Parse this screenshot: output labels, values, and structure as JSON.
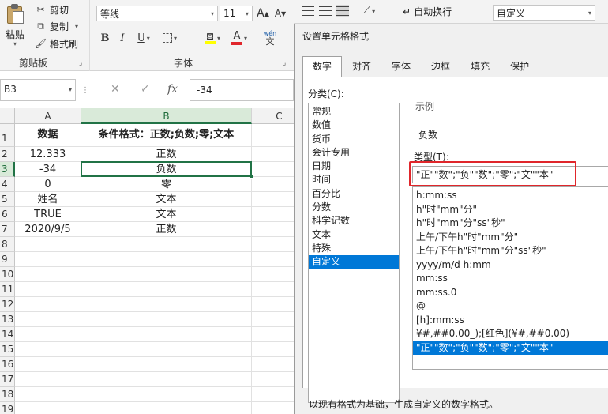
{
  "ribbon": {
    "clipboard": {
      "paste_label": "粘贴",
      "cut_label": "剪切",
      "copy_label": "复制",
      "format_painter_label": "格式刷",
      "group_label": "剪贴板"
    },
    "font": {
      "font_name": "等线",
      "font_size": "11",
      "grow_label": "A",
      "shrink_label": "A",
      "bold_label": "B",
      "italic_label": "I",
      "underline_label": "U",
      "fill_icon": "paint-bucket-icon",
      "font_color_label": "A",
      "phonetic_label": "wén",
      "phonetic_char": "文",
      "group_label": "字体",
      "fill_color": "#ffff00",
      "font_color": "#e0262b"
    },
    "alignment": {
      "wrap_text_label": "自动换行"
    },
    "number": {
      "format_value": "自定义"
    }
  },
  "formula_bar": {
    "name_box": "B3",
    "formula_value": "-34"
  },
  "sheet": {
    "columns": [
      "A",
      "B",
      "C"
    ],
    "rows": [
      "1",
      "2",
      "3",
      "4",
      "5",
      "6",
      "7",
      "8",
      "9",
      "10",
      "11",
      "12",
      "13",
      "14",
      "15",
      "16",
      "17",
      "18",
      "19"
    ],
    "header": {
      "a": "数据",
      "b": "条件格式：正数;负数;零;文本"
    },
    "data": [
      {
        "a": "12.333",
        "b": "正数"
      },
      {
        "a": "-34",
        "b": "负数"
      },
      {
        "a": "0",
        "b": "零"
      },
      {
        "a": "姓名",
        "b": "文本"
      },
      {
        "a": "TRUE",
        "b": "文本"
      },
      {
        "a": "2020/9/5",
        "b": "正数"
      }
    ],
    "selection_color": "#217346"
  },
  "dialog": {
    "title": "设置单元格格式",
    "tabs": [
      "数字",
      "对齐",
      "字体",
      "边框",
      "填充",
      "保护"
    ],
    "category_label": "分类(C):",
    "categories": [
      "常规",
      "数值",
      "货币",
      "会计专用",
      "日期",
      "时间",
      "百分比",
      "分数",
      "科学记数",
      "文本",
      "特殊",
      "自定义"
    ],
    "selected_category": 11,
    "sample_label": "示例",
    "sample_value": "负数",
    "type_label": "类型(T):",
    "type_value": "\"正\"\"数\";\"负\"\"数\";\"零\";\"文\"\"本\"",
    "type_list": [
      "h:mm:ss",
      "h\"时\"mm\"分\"",
      "h\"时\"mm\"分\"ss\"秒\"",
      "上午/下午h\"时\"mm\"分\"",
      "上午/下午h\"时\"mm\"分\"ss\"秒\"",
      "yyyy/m/d h:mm",
      "mm:ss",
      "mm:ss.0",
      "@",
      "[h]:mm:ss",
      "¥#,##0.00_);[红色](¥#,##0.00)",
      "\"正\"\"数\";\"负\"\"数\";\"零\";\"文\"\"本\""
    ],
    "selected_type": 11,
    "footer_text": "以现有格式为基础，生成自定义的数字格式。",
    "highlight_color": "#e0262b",
    "selection_color": "#0078d7"
  }
}
